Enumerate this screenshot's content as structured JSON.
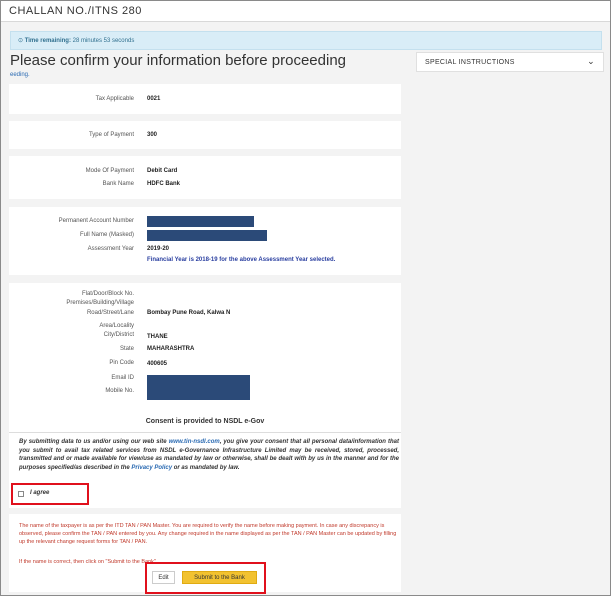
{
  "window": {
    "title": "CHALLAN NO./ITNS 280"
  },
  "timer": {
    "label": "Time remaining:",
    "value": "28 minutes 53 seconds"
  },
  "page": {
    "heading": "Please confirm your information before proceeding",
    "subnote": "eeding."
  },
  "special_instructions": {
    "label": "SPECIAL INSTRUCTIONS"
  },
  "tax": {
    "label": "Tax Applicable",
    "value": "0021"
  },
  "payment_type": {
    "label": "Type of Payment",
    "value": "300"
  },
  "payment": {
    "mode_label": "Mode Of Payment",
    "mode_value": "Debit Card",
    "bank_label": "Bank Name",
    "bank_value": "HDFC Bank"
  },
  "identity": {
    "pan_label": "Permanent Account Number",
    "name_label": "Full Name (Masked)",
    "ay_label": "Assessment Year",
    "ay_value": "2019-20",
    "fy_note": "Financial Year is 2018-19 for the above Assessment Year selected."
  },
  "address": {
    "flat_label": "Flat/Door/Block No.",
    "premises_label": "Premises/Building/Village",
    "road_label": "Road/Street/Lane",
    "road_value": "Bombay Pune Road, Kalwa N",
    "area_label": "Area/Locality",
    "city_label": "City/District",
    "city_value": "THANE",
    "state_label": "State",
    "state_value": "MAHARASHTRA",
    "pin_label": "Pin Code",
    "pin_value": "400605",
    "email_label": "Email ID",
    "mobile_label": "Mobile No."
  },
  "consent": {
    "title": "Consent is provided to NSDL e-Gov",
    "text_1": "By submitting data to us and/or using our web site ",
    "site": "www.tin-nsdl.com",
    "text_2": ", you give your consent that all personal data/information that you submit to avail tax related services from NSDL e-Governance Infrastructure Limited may be received, stored, processed, transmitted and or made available for view/use as mandated by law or otherwise, shall be dealt with by us in the manner and for the purposes specified/as described in the ",
    "policy": "Privacy Policy",
    "text_3": " or as mandated by law.",
    "agree_label": "I agree"
  },
  "warning": {
    "text": "The name of the taxpayer is as per the ITD TAN / PAN Master. You are required to verify the name before making payment. In case any discrepancy is observed, please confirm the TAN / PAN entered by you. Any change required in the name displayed as per the TAN / PAN Master can be updated by filling up the relevant change request forms for TAN / PAN.",
    "footer": "If the name is correct, then click on \"Submit to the Bank\""
  },
  "actions": {
    "edit_label": "Edit",
    "submit_label": "Submit to the Bank"
  },
  "colors": {
    "accent": "#f2c230",
    "highlight": "#e0101c",
    "mask": "#2b4a78"
  }
}
